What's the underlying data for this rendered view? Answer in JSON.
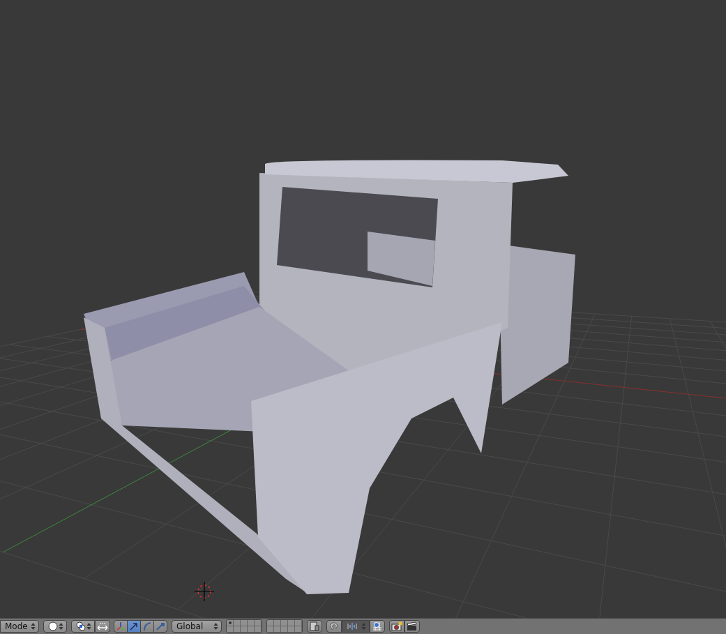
{
  "header": {
    "mode_menu": {
      "label": "Mode"
    },
    "shading": {
      "kind": "solid"
    },
    "pivot": {
      "kind": "median"
    },
    "manipulators": [
      {
        "kind": "axes",
        "selected": false
      },
      {
        "kind": "translate",
        "selected": true
      },
      {
        "kind": "rotate",
        "selected": false
      },
      {
        "kind": "scale",
        "selected": false
      }
    ],
    "orientation_menu": {
      "label": "Global"
    },
    "layers": [
      {
        "used": true
      },
      {
        "used": false
      },
      {
        "used": false
      },
      {
        "used": false
      },
      {
        "used": false
      },
      {
        "used": false
      },
      {
        "used": false
      },
      {
        "used": false
      },
      {
        "used": false
      },
      {
        "used": false
      },
      {
        "used": false
      },
      {
        "used": false
      },
      {
        "used": false
      },
      {
        "used": false
      },
      {
        "used": false
      },
      {
        "used": false
      },
      {
        "used": false
      },
      {
        "used": false
      },
      {
        "used": false
      },
      {
        "used": false
      }
    ],
    "snap": {
      "on": false
    }
  }
}
